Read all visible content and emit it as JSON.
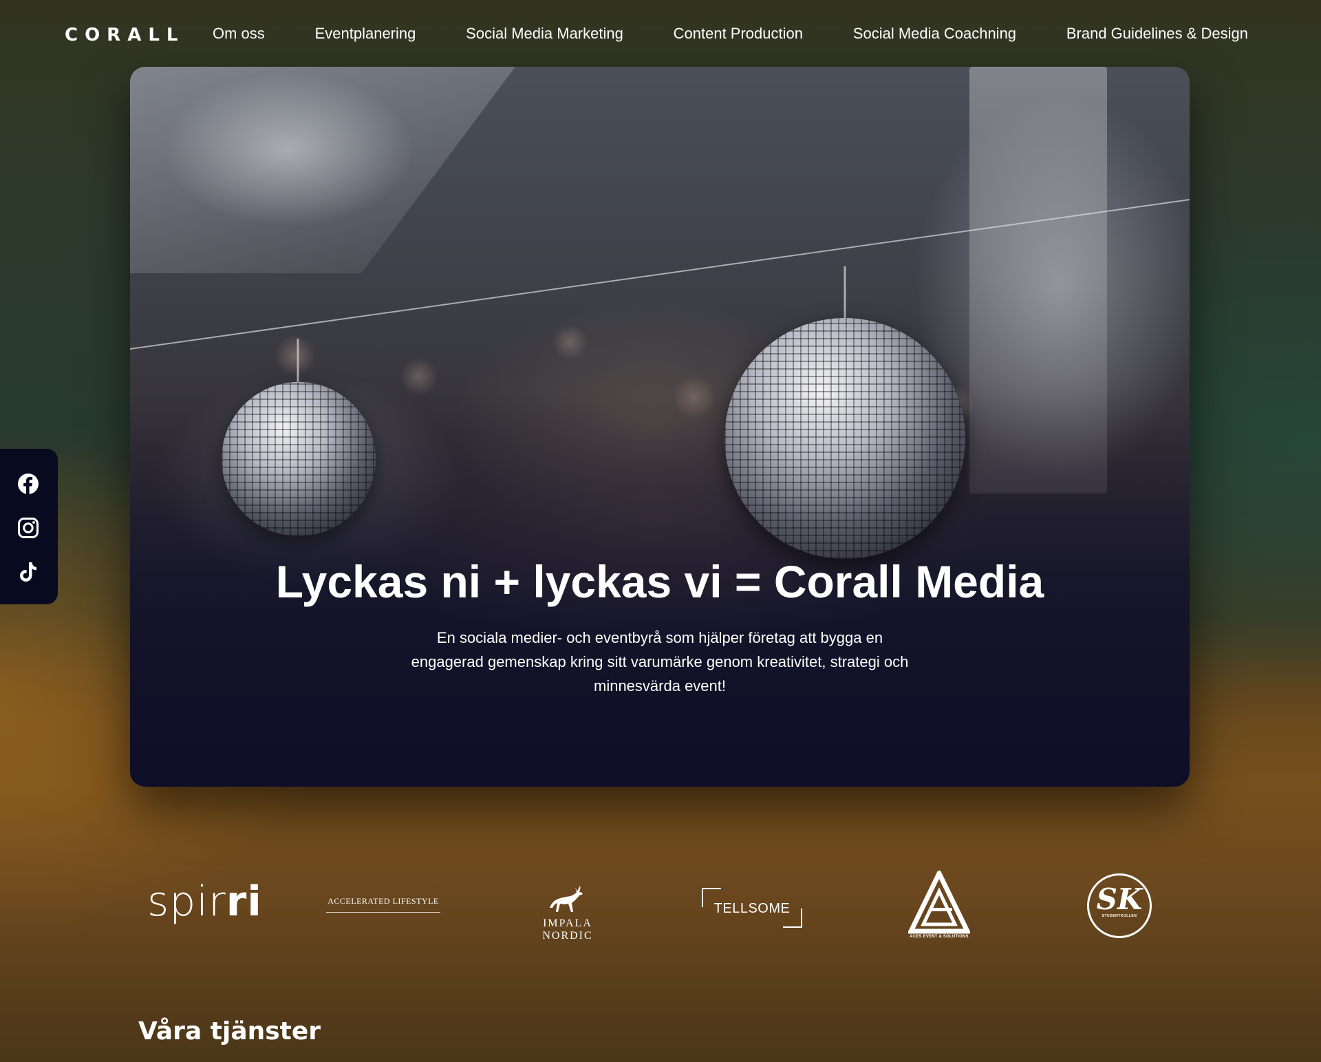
{
  "nav": {
    "logo": "CORALL",
    "links": [
      "Om oss",
      "Eventplanering",
      "Social Media Marketing",
      "Content Production",
      "Social Media Coachning",
      "Brand Guidelines & Design"
    ]
  },
  "hero": {
    "title": "Lyckas ni + lyckas vi = Corall Media",
    "subtitle": "En sociala medier- och eventbyrå som hjälper företag att bygga en engagerad gemenskap kring sitt varumärke genom kreativitet, strategi och minnesvärda event!"
  },
  "social": {
    "icons": [
      "facebook-icon",
      "instagram-icon",
      "tiktok-icon"
    ]
  },
  "clients": {
    "spirri_thin": "spir",
    "spirri_bold": "ri",
    "accelerated": "ACCELERATED LIFESTYLE",
    "impala": "IMPALA NORDIC",
    "tellsome": "TELLSOME",
    "aces": "ACES EVENT & SOLUTIONS",
    "sk_mark": "SK",
    "sk_text": "STUDENTKOLLEN"
  },
  "section": {
    "title": "Våra tjänster"
  },
  "colors": {
    "sidebar_bg": "#080b20",
    "text": "#ffffff",
    "background_top": "#32341f",
    "background_bottom": "#6b4a1d"
  }
}
